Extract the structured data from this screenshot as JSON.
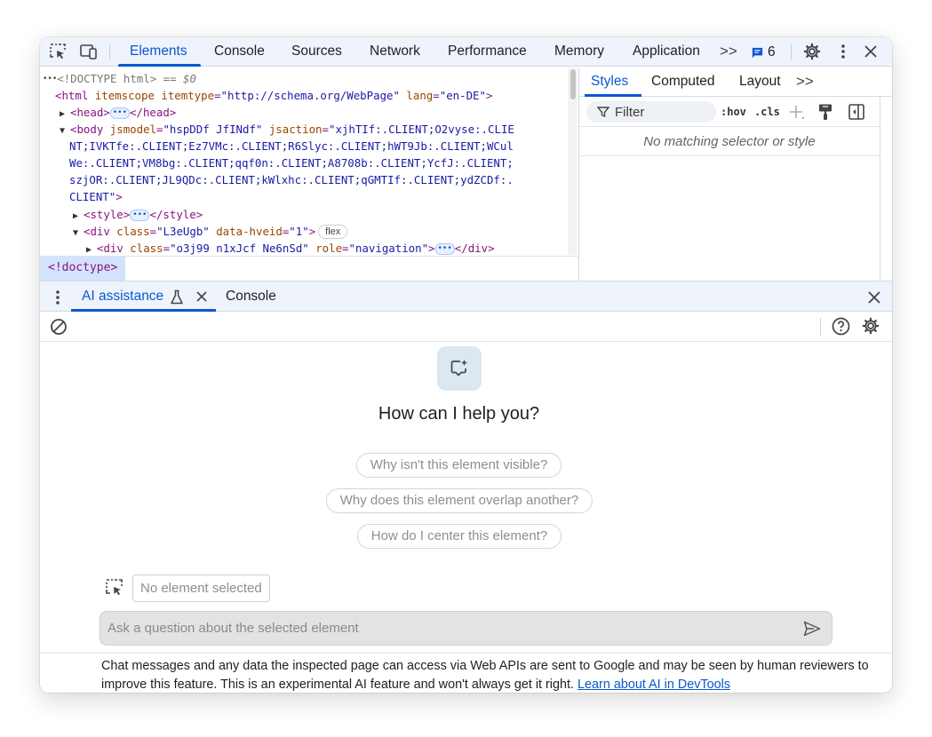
{
  "toolbar": {
    "tabs": [
      "Elements",
      "Console",
      "Sources",
      "Network",
      "Performance",
      "Memory",
      "Application"
    ],
    "more": ">>",
    "issues_count": "6"
  },
  "dom": {
    "line1": {
      "dots": "•••",
      "text": "<!DOCTYPE html>",
      "eq": " == ",
      "sel": "$0"
    },
    "line2": {
      "open": "<html",
      "a1": " itemscope",
      "a2": " itemtype",
      "v2": "\"http://schema.org/WebPage\"",
      "a3": " lang",
      "v3": "\"en-DE\"",
      "close": ">"
    },
    "line3": {
      "open": "<head>",
      "close": "</head>"
    },
    "line4": {
      "open": "<body",
      "a1": " jsmodel",
      "v1": "\"hspDDf JfINdf\"",
      "a2": " jsaction",
      "v2a": "\"xjhTIf:.CLIENT;O2vyse:.CLIE"
    },
    "line5": "NT;IVKTfe:.CLIENT;Ez7VMc:.CLIENT;R6Slyc:.CLIENT;hWT9Jb:.CLIENT;WCul",
    "line6": "We:.CLIENT;VM8bg:.CLIENT;qqf0n:.CLIENT;A8708b:.CLIENT;YcfJ:.CLIENT;",
    "line7": "szjOR:.CLIENT;JL9QDc:.CLIENT;kWlxhc:.CLIENT;qGMTIf:.CLIENT;ydZCDf:.",
    "line8": {
      "text": "CLIENT\"",
      "close": ">"
    },
    "line9": {
      "open": "<style>",
      "close": "</style>"
    },
    "line10": {
      "open": "<div",
      "a1": " class",
      "v1": "\"L3eUgb\"",
      "a2": " data-hveid",
      "v2": "\"1\"",
      "close": ">",
      "badge": "flex"
    },
    "line11": {
      "open": "<div",
      "a1": " class",
      "v1": "\"o3j99 n1xJcf Ne6nSd\"",
      "a2": " role",
      "v2": "\"navigation\"",
      "close": ">",
      "end": "</div>"
    },
    "ellipsis": "•••",
    "eq": "=",
    "breadcrumb": "<!doctype>"
  },
  "styles": {
    "tabs": [
      "Styles",
      "Computed",
      "Layout"
    ],
    "more": ">>",
    "filter_placeholder": "Filter",
    "hov": ":hov",
    "cls": ".cls",
    "no_match": "No matching selector or style"
  },
  "drawer": {
    "tabs": [
      "AI assistance",
      "Console"
    ]
  },
  "ai": {
    "title": "How can I help you?",
    "suggestions": [
      "Why isn't this element visible?",
      "Why does this element overlap another?",
      "How do I center this element?"
    ],
    "no_element": "No element selected",
    "input_placeholder": "Ask a question about the selected element",
    "disclaimer": "Chat messages and any data the inspected page can access via Web APIs are sent to Google and may be seen by human reviewers to improve this feature. This is an experimental AI feature and won't always get it right.",
    "learn_link": "Learn about AI in DevTools"
  }
}
